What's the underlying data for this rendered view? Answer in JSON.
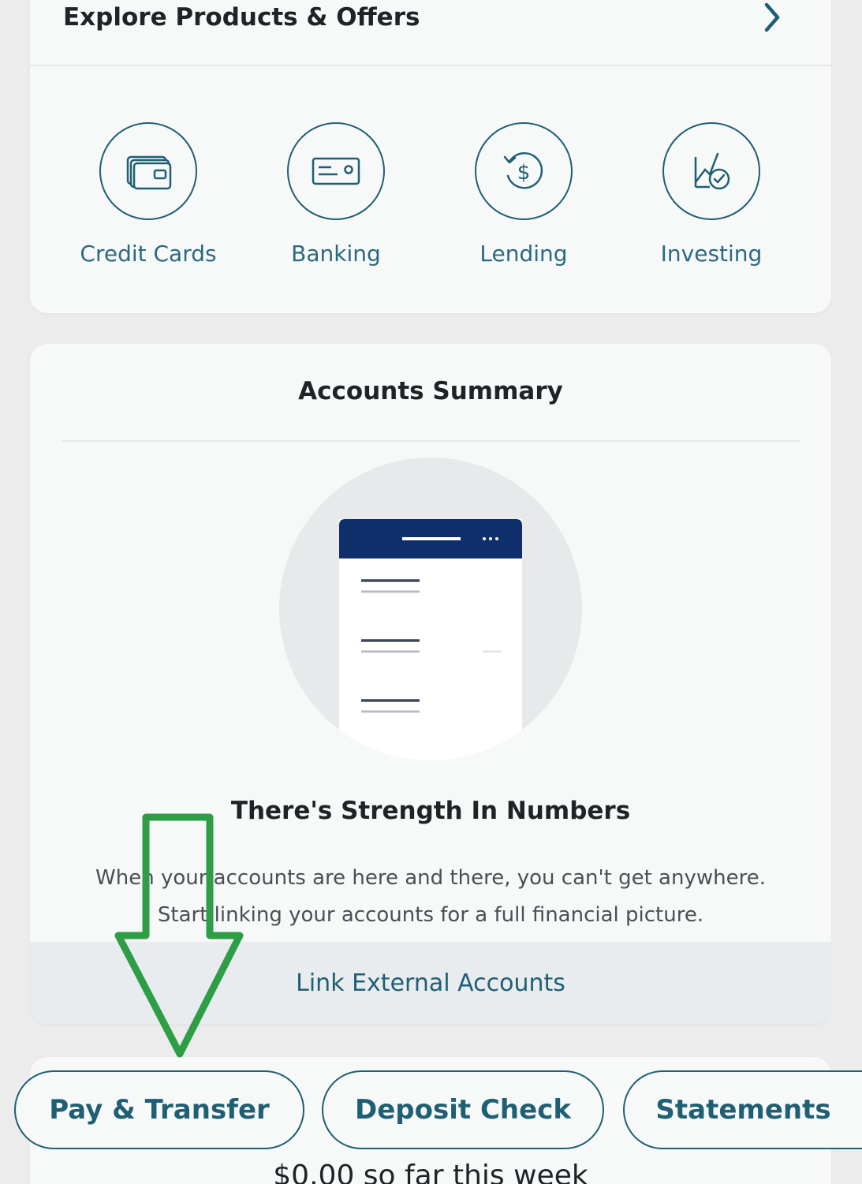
{
  "explore": {
    "title": "Explore Products & Offers",
    "products": [
      {
        "label": "Credit Cards",
        "icon": "credit-cards-icon"
      },
      {
        "label": "Banking",
        "icon": "banking-icon"
      },
      {
        "label": "Lending",
        "icon": "lending-icon"
      },
      {
        "label": "Investing",
        "icon": "investing-icon"
      }
    ]
  },
  "summary": {
    "title": "Accounts Summary",
    "promo_title": "There's Strength In Numbers",
    "promo_body": "When your accounts are here and there, you can't get anywhere. Start linking your accounts for a full financial picture.",
    "link_label": "Link External Accounts"
  },
  "quick_actions": [
    {
      "label": "Pay & Transfer"
    },
    {
      "label": "Deposit Check"
    },
    {
      "label": "Statements"
    }
  ],
  "weekly": {
    "text": "$0.00 so far this week"
  },
  "colors": {
    "accent": "#1f5f73",
    "background": "#ececed",
    "card": "#f7f8f8",
    "illustration_header": "#0f2f6b",
    "annotation_arrow": "#2e9e46"
  }
}
